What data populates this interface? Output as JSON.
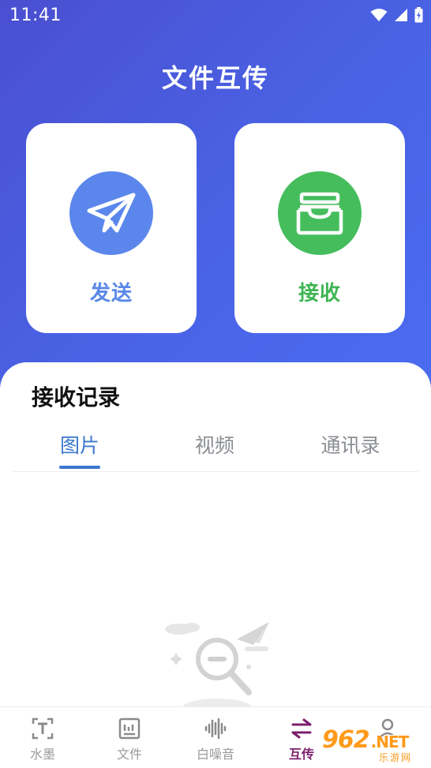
{
  "status_bar": {
    "time": "11:41"
  },
  "header": {
    "title": "文件互传"
  },
  "actions": {
    "send_label": "发送",
    "receive_label": "接收"
  },
  "records": {
    "title": "接收记录",
    "tabs": [
      {
        "label": "图片",
        "selected": true
      },
      {
        "label": "视频",
        "selected": false
      },
      {
        "label": "通讯录",
        "selected": false
      }
    ]
  },
  "bottom_nav": {
    "items": [
      {
        "label": "水墨",
        "icon": "text-frame-icon",
        "active": false
      },
      {
        "label": "文件",
        "icon": "file-icon",
        "active": false
      },
      {
        "label": "白噪音",
        "icon": "sound-wave-icon",
        "active": false
      },
      {
        "label": "互传",
        "icon": "swap-arrows-icon",
        "active": true
      },
      {
        "label": "",
        "icon": "user-icon",
        "active": false
      }
    ]
  },
  "watermark": {
    "text": "962",
    "suffix": ".NET",
    "subtitle": "乐游网"
  },
  "colors": {
    "hero_gradient_start": "#4a4fd0",
    "hero_gradient_end": "#4b6cf0",
    "send_blue": "#5b87ec",
    "receive_green": "#45bd5c",
    "tab_active": "#3b77cc",
    "nav_active": "#7c1f6d"
  }
}
